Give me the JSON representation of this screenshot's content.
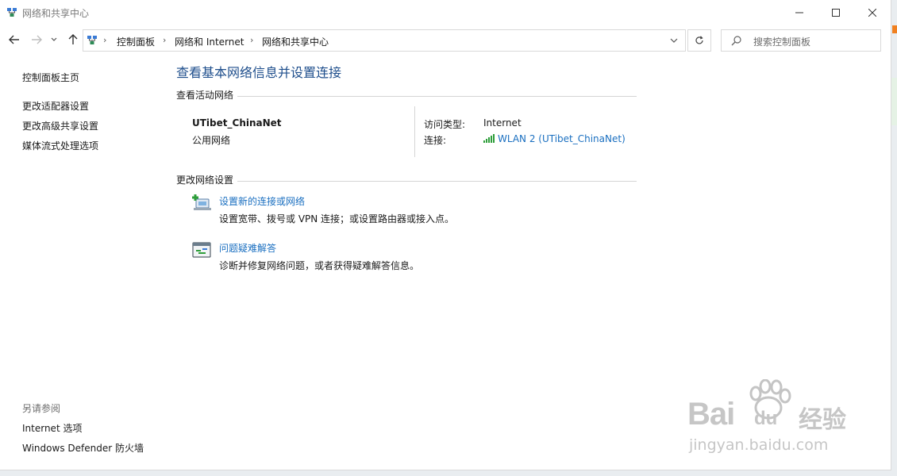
{
  "window": {
    "title": "网络和共享中心"
  },
  "address_bar": {
    "breadcrumbs": [
      "控制面板",
      "网络和 Internet",
      "网络和共享中心"
    ]
  },
  "search": {
    "placeholder": "搜索控制面板"
  },
  "sidebar": {
    "home_link": "控制面板主页",
    "links": [
      "更改适配器设置",
      "更改高级共享设置",
      "媒体流式处理选项"
    ],
    "see_also_header": "另请参阅",
    "see_also_links": [
      "Internet 选项",
      "Windows Defender 防火墙"
    ]
  },
  "main": {
    "title": "查看基本网络信息并设置连接",
    "active_networks_header": "查看活动网络",
    "network": {
      "name": "UTibet_ChinaNet",
      "category": "公用网络",
      "access_type_label": "访问类型:",
      "access_type_value": "Internet",
      "connections_label": "连接:",
      "connection_link": "WLAN 2 (UTibet_ChinaNet)"
    },
    "change_settings_header": "更改网络设置",
    "tasks": [
      {
        "link": "设置新的连接或网络",
        "description": "设置宽带、拨号或 VPN 连接；或设置路由器或接入点。"
      },
      {
        "link": "问题疑难解答",
        "description": "诊断并修复网络问题，或者获得疑难解答信息。"
      }
    ]
  },
  "watermark": {
    "brand": "Bai",
    "brand2": "du",
    "cn": "经验",
    "url": "jingyan.baidu.com"
  },
  "colors": {
    "title_blue": "#1e4e8c",
    "link_blue": "#1a6fc0"
  }
}
